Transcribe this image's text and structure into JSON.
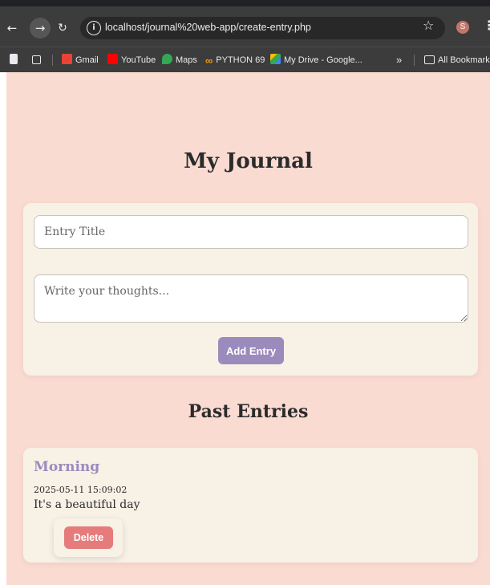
{
  "browser": {
    "url": "localhost/journal%20web-app/create-entry.php",
    "profile_initial": "S",
    "icons": {
      "back": "arrow-left-icon",
      "forward": "arrow-right-icon",
      "reload": "reload-icon",
      "site_info": "info-icon",
      "bookmark_star": "star-icon",
      "menu": "kebab-menu-icon"
    },
    "bookmarks": [
      {
        "label": "Gmail",
        "icon": "gmail-icon",
        "color": "#ea4335"
      },
      {
        "label": "YouTube",
        "icon": "youtube-icon",
        "color": "#ff0000"
      },
      {
        "label": "Maps",
        "icon": "maps-icon",
        "color": "#34a853"
      },
      {
        "label": "PYTHON 69",
        "icon": "infinity-icon",
        "color": "#f59e0b"
      },
      {
        "label": "My Drive - Google...",
        "icon": "drive-icon",
        "color": "#fbbc04"
      }
    ],
    "more_bookmarks": "»",
    "all_bookmarks": "All Bookmarks"
  },
  "page": {
    "title": "My Journal",
    "background_color": "#fadbd2",
    "form": {
      "title_placeholder": "Entry Title",
      "title_value": "",
      "body_placeholder": "Write your thoughts...",
      "body_value": "",
      "submit_label": "Add Entry",
      "accent_color": "#9b8bbd"
    },
    "past_entries_heading": "Past Entries",
    "entries": [
      {
        "title": "Morning",
        "timestamp": "2025-05-11 15:09:02",
        "body": "It's a beautiful day",
        "delete_label": "Delete",
        "delete_color": "#e57b7b"
      }
    ]
  }
}
